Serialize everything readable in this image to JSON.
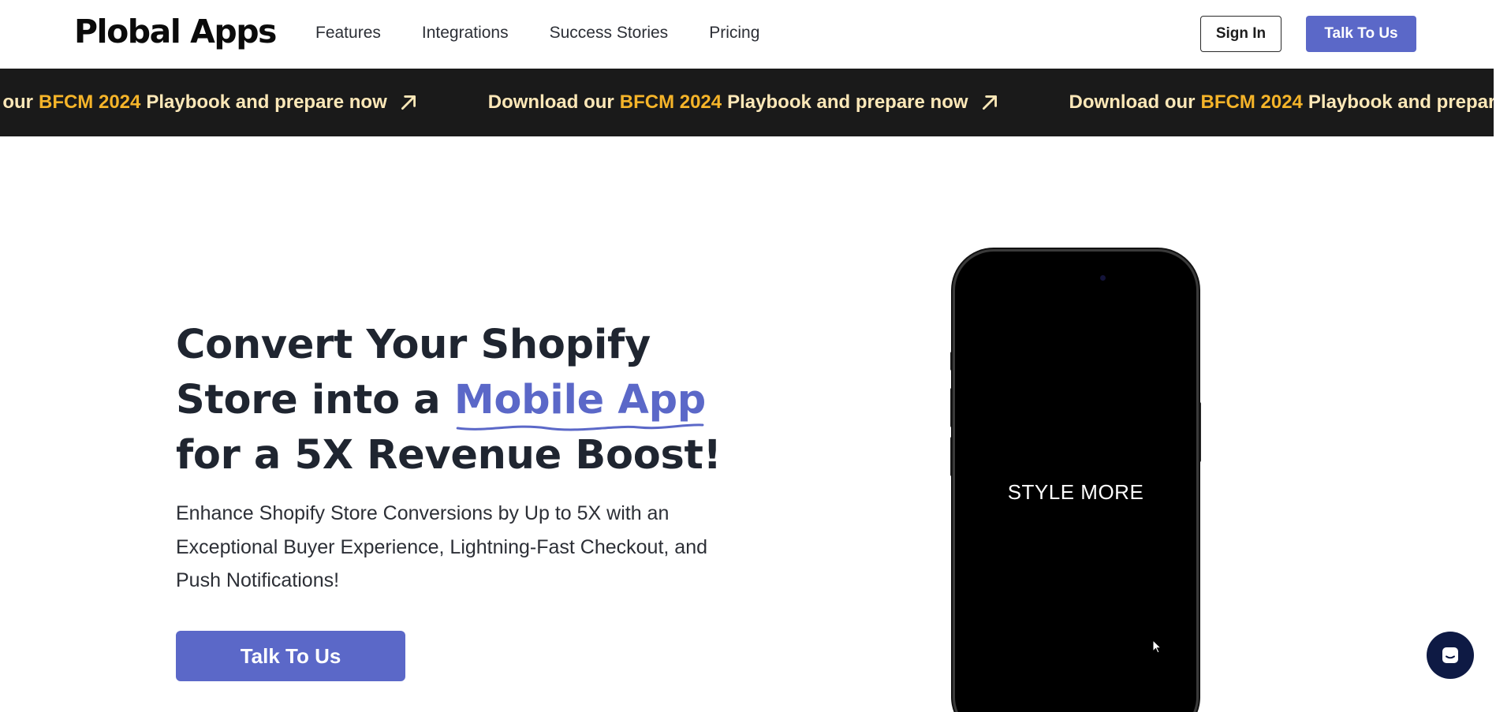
{
  "header": {
    "logo": "Plobal Apps",
    "nav": [
      "Features",
      "Integrations",
      "Success Stories",
      "Pricing"
    ],
    "sign_in": "Sign In",
    "talk_to_us": "Talk To Us"
  },
  "banner": {
    "prefix": "Download our",
    "highlight": "BFCM 2024",
    "suffix": "Playbook and prepare now",
    "icon": "arrow-up-right-icon",
    "colors": {
      "background": "#1a1a1a",
      "text": "#fde8b8",
      "highlight": "#f5b429"
    }
  },
  "hero": {
    "title_line1": "Convert Your Shopify",
    "title_line2_prefix": "Store into a",
    "title_accent": "Mobile App",
    "title_line3": "for a 5X Revenue Boost!",
    "subtitle": "Enhance Shopify Store Conversions by Up to 5X with an Exceptional Buyer Experience, Lightning-Fast Checkout, and Push Notifications!",
    "cta": "Talk To Us"
  },
  "phone": {
    "screen_text": "STYLE MORE"
  },
  "chat": {
    "icon": "chat-bubble-icon"
  },
  "colors": {
    "accent": "#5b68c8",
    "heading": "#1f2530",
    "chat": "#0e1a44"
  }
}
